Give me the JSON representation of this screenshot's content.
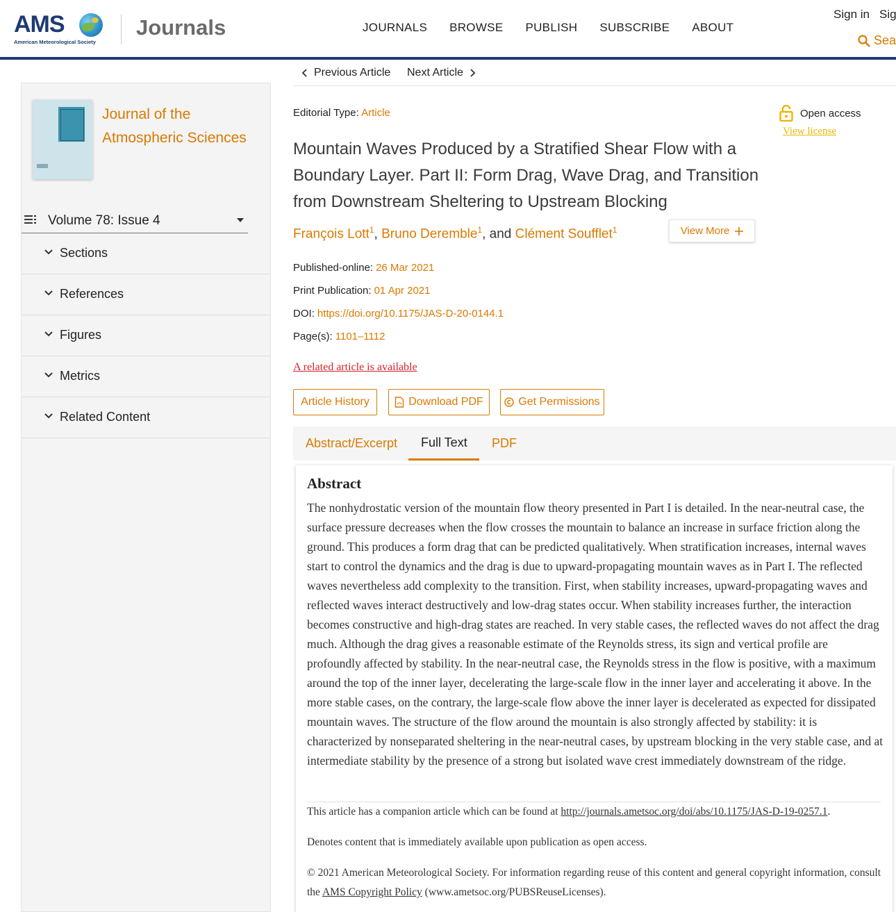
{
  "header": {
    "logo_text": "AMS",
    "logo_sub": "American Meteorological Society",
    "journals_label": "Journals",
    "nav": [
      "JOURNALS",
      "BROWSE",
      "PUBLISH",
      "SUBSCRIBE",
      "ABOUT"
    ],
    "sign_in": "Sign in",
    "sign_up": "Sig",
    "search_label": "Sea"
  },
  "sidebar": {
    "journal_title": "Journal of the Atmospheric Sciences",
    "issue": "Volume 78: Issue 4",
    "items": [
      "Sections",
      "References",
      "Figures",
      "Metrics",
      "Related Content"
    ]
  },
  "article_nav": {
    "previous": "Previous Article",
    "next": "Next Article"
  },
  "article": {
    "editorial_type_label": "Editorial Type:",
    "editorial_type_value": "Article",
    "open_access": "Open access",
    "view_license": "View license",
    "title": "Mountain Waves Produced by a Stratified Shear Flow with a Boundary Layer. Part II: Form Drag, Wave Drag, and Transition from Downstream Sheltering to Upstream Blocking",
    "authors": [
      {
        "name": "François Lott",
        "sup": "1"
      },
      {
        "name": "Bruno Deremble",
        "sup": "1"
      },
      {
        "name": "Clément Soufflet",
        "sup": "1"
      }
    ],
    "sep_comma": ",",
    "sep_and": ", and",
    "view_more": "View More",
    "published_online_label": "Published-online:",
    "published_online": "26 Mar 2021",
    "print_publication_label": "Print Publication:",
    "print_publication": "01 Apr 2021",
    "doi_label": "DOI:",
    "doi": "https://doi.org/10.1175/JAS-D-20-0144.1",
    "pages_label": "Page(s):",
    "pages": "1101–1112",
    "related_article": "A related article is available",
    "buttons": {
      "history": "Article History",
      "download_pdf": "Download PDF",
      "permissions": "Get Permissions"
    }
  },
  "tabs": [
    "Abstract/Excerpt",
    "Full Text",
    "PDF"
  ],
  "active_tab": "Full Text",
  "abstract": {
    "heading": "Abstract",
    "text": "The nonhydrostatic version of the mountain flow theory presented in Part I is detailed. In the near-neutral case, the surface pressure decreases when the flow crosses the mountain to balance an increase in surface friction along the ground. This produces a form drag that can be predicted qualitatively. When stratification increases, internal waves start to control the dynamics and the drag is due to upward-propagating mountain waves as in Part I. The reflected waves nevertheless add complexity to the transition. First, when stability increases, upward-propagating waves and reflected waves interact destructively and low-drag states occur. When stability increases further, the interaction becomes constructive and high-drag states are reached. In very stable cases, the reflected waves do not affect the drag much. Although the drag gives a reasonable estimate of the Reynolds stress, its sign and vertical profile are profoundly affected by stability. In the near-neutral case, the Reynolds stress in the flow is positive, with a maximum around the top of the inner layer, decelerating the large-scale flow in the inner layer and accelerating it above. In the more stable cases, on the contrary, the large-scale flow above the inner layer is decelerated as expected for dissipated mountain waves. The structure of the flow around the mountain is also strongly affected by stability: it is characterized by nonseparated sheltering in the near-neutral cases, by upstream blocking in the very stable case, and at intermediate stability by the presence of a strong but isolated wave crest immediately downstream of the ridge.",
    "companion_prefix": "This article has a companion article which can be found at",
    "companion_link": "http://journals.ametsoc.org/doi/abs/10.1175/JAS-D-19-0257.1",
    "companion_suffix": ".",
    "open_access_note": "Denotes content that is immediately available upon publication as open access.",
    "copyright_prefix": "© 2021 American Meteorological Society. For information regarding reuse of this content and general copyright information, consult the",
    "copyright_link": "AMS Copyright Policy",
    "copyright_url": "(www.ametsoc.org/PUBSReuseLicenses)",
    "copyright_suffix": "."
  },
  "colors": {
    "accent": "#d97a00",
    "brand_navy": "#1d3a73",
    "related_red": "#d2232a",
    "license_yellow": "#f0b400"
  }
}
